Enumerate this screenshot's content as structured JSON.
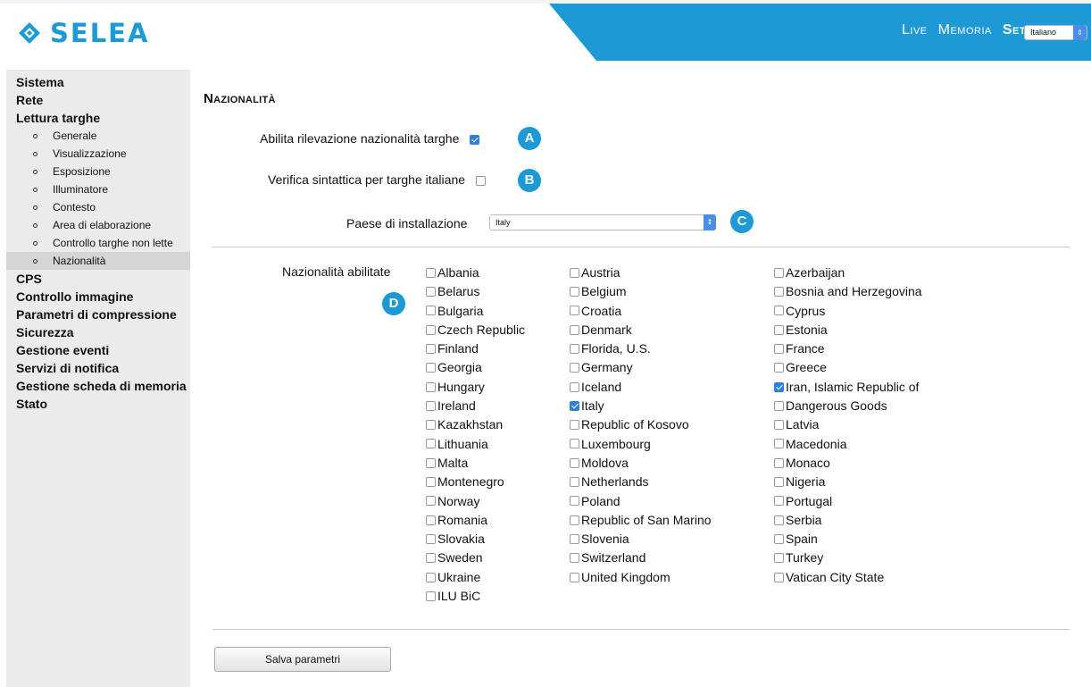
{
  "header": {
    "logo_text": "SELEA",
    "nav": [
      "Live",
      "Memoria",
      "Setup"
    ],
    "active_nav": "Setup",
    "language": "Italiano",
    "accent_color": "#1d9ad6"
  },
  "sidebar": {
    "items": [
      {
        "label": "Sistema"
      },
      {
        "label": "Rete"
      },
      {
        "label": "Lettura targhe"
      }
    ],
    "subitems": [
      "Generale",
      "Visualizzazione",
      "Esposizione",
      "Illuminatore",
      "Contesto",
      "Area di elaborazione",
      "Controllo targhe non lette",
      "Nazionalità"
    ],
    "after_items": [
      "CPS",
      "Controllo immagine",
      "Parametri di compressione",
      "Sicurezza",
      "Gestione eventi",
      "Servizi di notifica",
      "Gestione scheda di memoria",
      "Stato"
    ]
  },
  "main": {
    "title": "Nazionalità",
    "enable_label": "Abilita rilevazione nazionalità targhe",
    "enable_checked": true,
    "verify_label": "Verifica sintattica per targhe italiane",
    "verify_checked": false,
    "country_label": "Paese di installazione",
    "country_value": "Italy",
    "nationalities_label": "Nazionalità abilitate",
    "badges": [
      "A",
      "B",
      "C",
      "D"
    ],
    "save_button": "Salva parametri"
  },
  "countries": {
    "col1": [
      {
        "name": "Albania",
        "checked": false
      },
      {
        "name": "Belarus",
        "checked": false
      },
      {
        "name": "Bulgaria",
        "checked": false
      },
      {
        "name": "Czech Republic",
        "checked": false
      },
      {
        "name": "Finland",
        "checked": false
      },
      {
        "name": "Georgia",
        "checked": false
      },
      {
        "name": "Hungary",
        "checked": false
      },
      {
        "name": "Ireland",
        "checked": false
      },
      {
        "name": "Kazakhstan",
        "checked": false
      },
      {
        "name": "Lithuania",
        "checked": false
      },
      {
        "name": "Malta",
        "checked": false
      },
      {
        "name": "Montenegro",
        "checked": false
      },
      {
        "name": "Norway",
        "checked": false
      },
      {
        "name": "Romania",
        "checked": false
      },
      {
        "name": "Slovakia",
        "checked": false
      },
      {
        "name": "Sweden",
        "checked": false
      },
      {
        "name": "Ukraine",
        "checked": false
      },
      {
        "name": "ILU BiC",
        "checked": false
      }
    ],
    "col2": [
      {
        "name": "Austria",
        "checked": false
      },
      {
        "name": "Belgium",
        "checked": false
      },
      {
        "name": "Croatia",
        "checked": false
      },
      {
        "name": "Denmark",
        "checked": false
      },
      {
        "name": "Florida, U.S.",
        "checked": false
      },
      {
        "name": "Germany",
        "checked": false
      },
      {
        "name": "Iceland",
        "checked": false
      },
      {
        "name": "Italy",
        "checked": true
      },
      {
        "name": "Republic of Kosovo",
        "checked": false
      },
      {
        "name": "Luxembourg",
        "checked": false
      },
      {
        "name": "Moldova",
        "checked": false
      },
      {
        "name": "Netherlands",
        "checked": false
      },
      {
        "name": "Poland",
        "checked": false
      },
      {
        "name": "Republic of San Marino",
        "checked": false
      },
      {
        "name": "Slovenia",
        "checked": false
      },
      {
        "name": "Switzerland",
        "checked": false
      },
      {
        "name": "United Kingdom",
        "checked": false
      }
    ],
    "col3": [
      {
        "name": "Azerbaijan",
        "checked": false
      },
      {
        "name": "Bosnia and Herzegovina",
        "checked": false
      },
      {
        "name": "Cyprus",
        "checked": false
      },
      {
        "name": "Estonia",
        "checked": false
      },
      {
        "name": "France",
        "checked": false
      },
      {
        "name": "Greece",
        "checked": false
      },
      {
        "name": "Iran, Islamic Republic of",
        "checked": true
      },
      {
        "name": "Dangerous Goods",
        "checked": false
      },
      {
        "name": "Latvia",
        "checked": false
      },
      {
        "name": "Macedonia",
        "checked": false
      },
      {
        "name": "Monaco",
        "checked": false
      },
      {
        "name": "Nigeria",
        "checked": false
      },
      {
        "name": "Portugal",
        "checked": false
      },
      {
        "name": "Serbia",
        "checked": false
      },
      {
        "name": "Spain",
        "checked": false
      },
      {
        "name": "Turkey",
        "checked": false
      },
      {
        "name": "Vatican City State",
        "checked": false
      }
    ]
  }
}
